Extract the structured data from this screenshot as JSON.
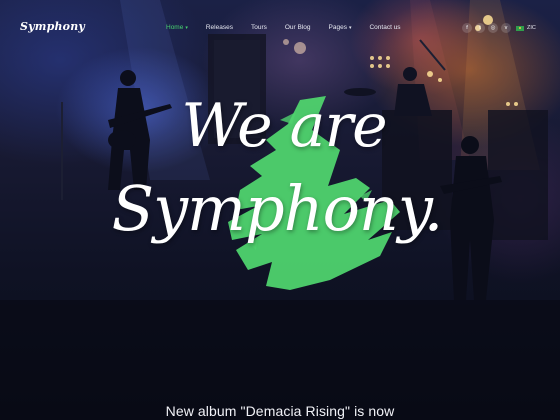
{
  "logo": "Symphony",
  "nav": {
    "items": [
      {
        "label": "Home",
        "has_dropdown": true,
        "active": true
      },
      {
        "label": "Releases",
        "has_dropdown": false,
        "active": false
      },
      {
        "label": "Tours",
        "has_dropdown": false,
        "active": false
      },
      {
        "label": "Our Blog",
        "has_dropdown": false,
        "active": false
      },
      {
        "label": "Pages",
        "has_dropdown": true,
        "active": false
      },
      {
        "label": "Contact us",
        "has_dropdown": false,
        "active": false
      }
    ],
    "active_color": "#47d16f",
    "caret": "▾"
  },
  "social": {
    "icons": [
      {
        "name": "facebook",
        "glyph": "f"
      },
      {
        "name": "twitter",
        "glyph": "t"
      },
      {
        "name": "instagram",
        "glyph": "◎"
      },
      {
        "name": "vimeo",
        "glyph": "v"
      }
    ],
    "language": "ZIC"
  },
  "hero": {
    "line1": "We are",
    "line2": "Symphony.",
    "brush_color": "#4fd36e",
    "tagline": "New album \"Demacia Rising\" is now"
  }
}
